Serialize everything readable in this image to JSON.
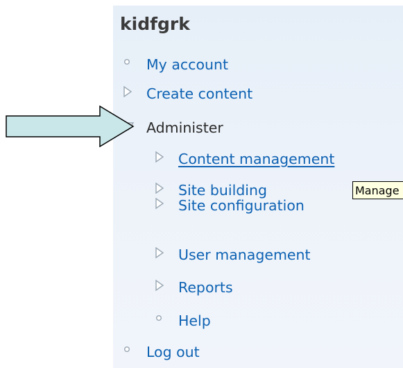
{
  "block": {
    "title": "kidfgrk"
  },
  "menu": {
    "top_items": [
      {
        "label": "My account",
        "bullet": "leaf"
      },
      {
        "label": "Create content",
        "bullet": "collapsed"
      },
      {
        "label": "Administer",
        "bullet": "expanded"
      },
      {
        "label": "Log out",
        "bullet": "leaf"
      }
    ],
    "admin_children": [
      {
        "label": "Content management",
        "bullet": "collapsed"
      },
      {
        "label": "Site building",
        "bullet": "collapsed"
      },
      {
        "label": "Site configuration",
        "bullet": "collapsed"
      },
      {
        "label": "User management",
        "bullet": "collapsed"
      },
      {
        "label": "Reports",
        "bullet": "collapsed"
      },
      {
        "label": "Help",
        "bullet": "leaf"
      }
    ]
  },
  "tooltip": {
    "text": "Manage"
  },
  "colors": {
    "link": "#0e62b3",
    "active_text": "#2a2a2a",
    "panel_background": "#e6eff8",
    "arrow_fill": "#c9e6e8",
    "tooltip_background": "#ffffe1"
  },
  "annotation": {
    "icon": "callout-arrow-icon"
  }
}
